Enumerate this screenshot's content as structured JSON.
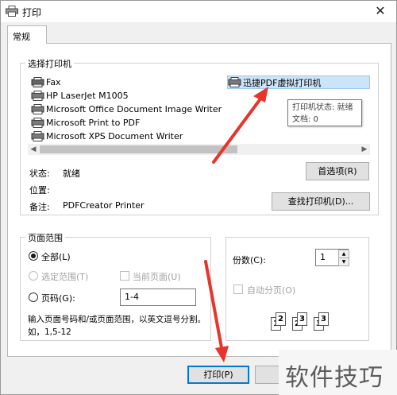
{
  "window": {
    "title": "打印",
    "close_glyph": "✕"
  },
  "tab": {
    "label": "常规"
  },
  "printer_group": {
    "legend": "选择打印机",
    "printers": [
      {
        "name": "Fax",
        "icon": "fax-icon"
      },
      {
        "name": "HP LaserJet M1005",
        "icon": "printer-icon"
      },
      {
        "name": "Microsoft Office Document Image Writer",
        "icon": "printer-icon"
      },
      {
        "name": "Microsoft Print to PDF",
        "icon": "printer-icon"
      },
      {
        "name": "Microsoft XPS Document Writer",
        "icon": "printer-icon"
      },
      {
        "name": "迅捷PDF虚拟打印机",
        "icon": "printer-icon",
        "selected": true
      }
    ],
    "tooltip": {
      "status": "打印机状态: 就绪",
      "docs": "文档: 0"
    },
    "status_label": "状态:",
    "status_value": "就绪",
    "location_label": "位置:",
    "location_value": "",
    "comment_label": "备注:",
    "comment_value": "PDFCreator Printer",
    "preferences_button": "首选项(R)",
    "find_printer_button": "查找打印机(D)..."
  },
  "page_range": {
    "legend": "页面范围",
    "all": "全部(L)",
    "selection": "选定范围(T)",
    "current_page": "当前页面(U)",
    "pages": "页码(G):",
    "pages_value": "1-4",
    "hint": "输入页面号码和/或页面范围，以英文逗号分割。如，1,5-12"
  },
  "copies": {
    "label": "份数(C):",
    "value": "1",
    "collate": "自动分页(O)"
  },
  "footer": {
    "print_button": "打印(P)"
  },
  "watermark": {
    "text": "软件技巧"
  },
  "colors": {
    "arrow": "#e8352b",
    "selection": "#cce4f7",
    "accent": "#0078d7"
  }
}
